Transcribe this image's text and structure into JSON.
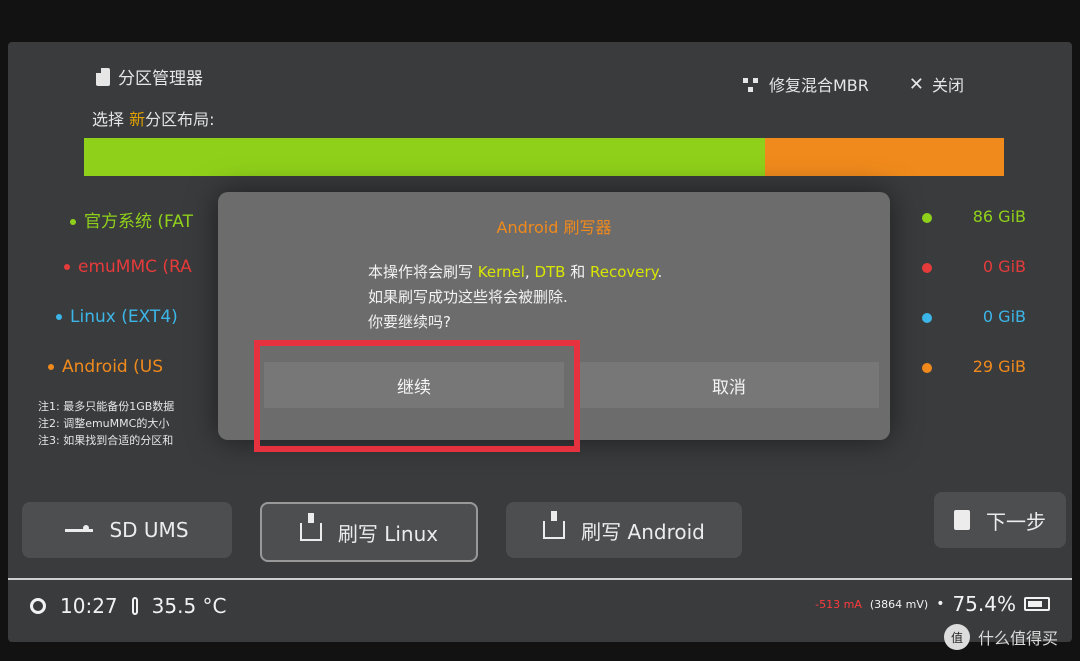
{
  "app": {
    "title": "分区管理器"
  },
  "top_actions": {
    "mbr_label": "修复混合MBR",
    "close_label": "关闭"
  },
  "select_label": {
    "prefix": "选择 ",
    "highlight": "新",
    "suffix": "分区布局:"
  },
  "partitions": [
    {
      "label": "官方系统 (FAT",
      "size": "86 GiB",
      "color": "#8fd11a",
      "share": 0.74
    },
    {
      "label": "emuMMC (RA",
      "size": "0 GiB",
      "color": "#e53b3b",
      "share": 0.0
    },
    {
      "label": "Linux (EXT4)",
      "size": "0 GiB",
      "color": "#3cb6e8",
      "share": 0.0
    },
    {
      "label": "Android (US",
      "size": "29 GiB",
      "color": "#f08a1c",
      "share": 0.26
    }
  ],
  "notes": [
    "注1: 最多只能备份1GB数据",
    "注2: 调整emuMMC的大小",
    "注3: 如果找到合适的分区和"
  ],
  "modal": {
    "title": "Android 刷写器",
    "line1_prefix": "本操作将会刷写 ",
    "kernel": "Kernel",
    "comma": ", ",
    "dtb": "DTB",
    "and": " 和 ",
    "recovery": "Recovery",
    "period": ".",
    "line2": "如果刷写成功这些将会被删除.",
    "line3": "你要继续吗?",
    "continue_label": "继续",
    "cancel_label": "取消"
  },
  "bottom_buttons": {
    "ums": "SD UMS",
    "flash_linux": "刷写 Linux",
    "flash_android": "刷写 Android",
    "next": "下一步"
  },
  "status": {
    "time": "10:27",
    "temp": "35.5 °C",
    "current": "-513 mA",
    "voltage": "(3864 mV)",
    "battery": "75.4%"
  },
  "watermark": {
    "text": "什么值得买",
    "logo": "值"
  },
  "colors": {
    "green": "#8fd11a",
    "orange": "#f08a1c",
    "red": "#e53b3b",
    "blue": "#3cb6e8",
    "highlight_box": "#e5323e"
  }
}
